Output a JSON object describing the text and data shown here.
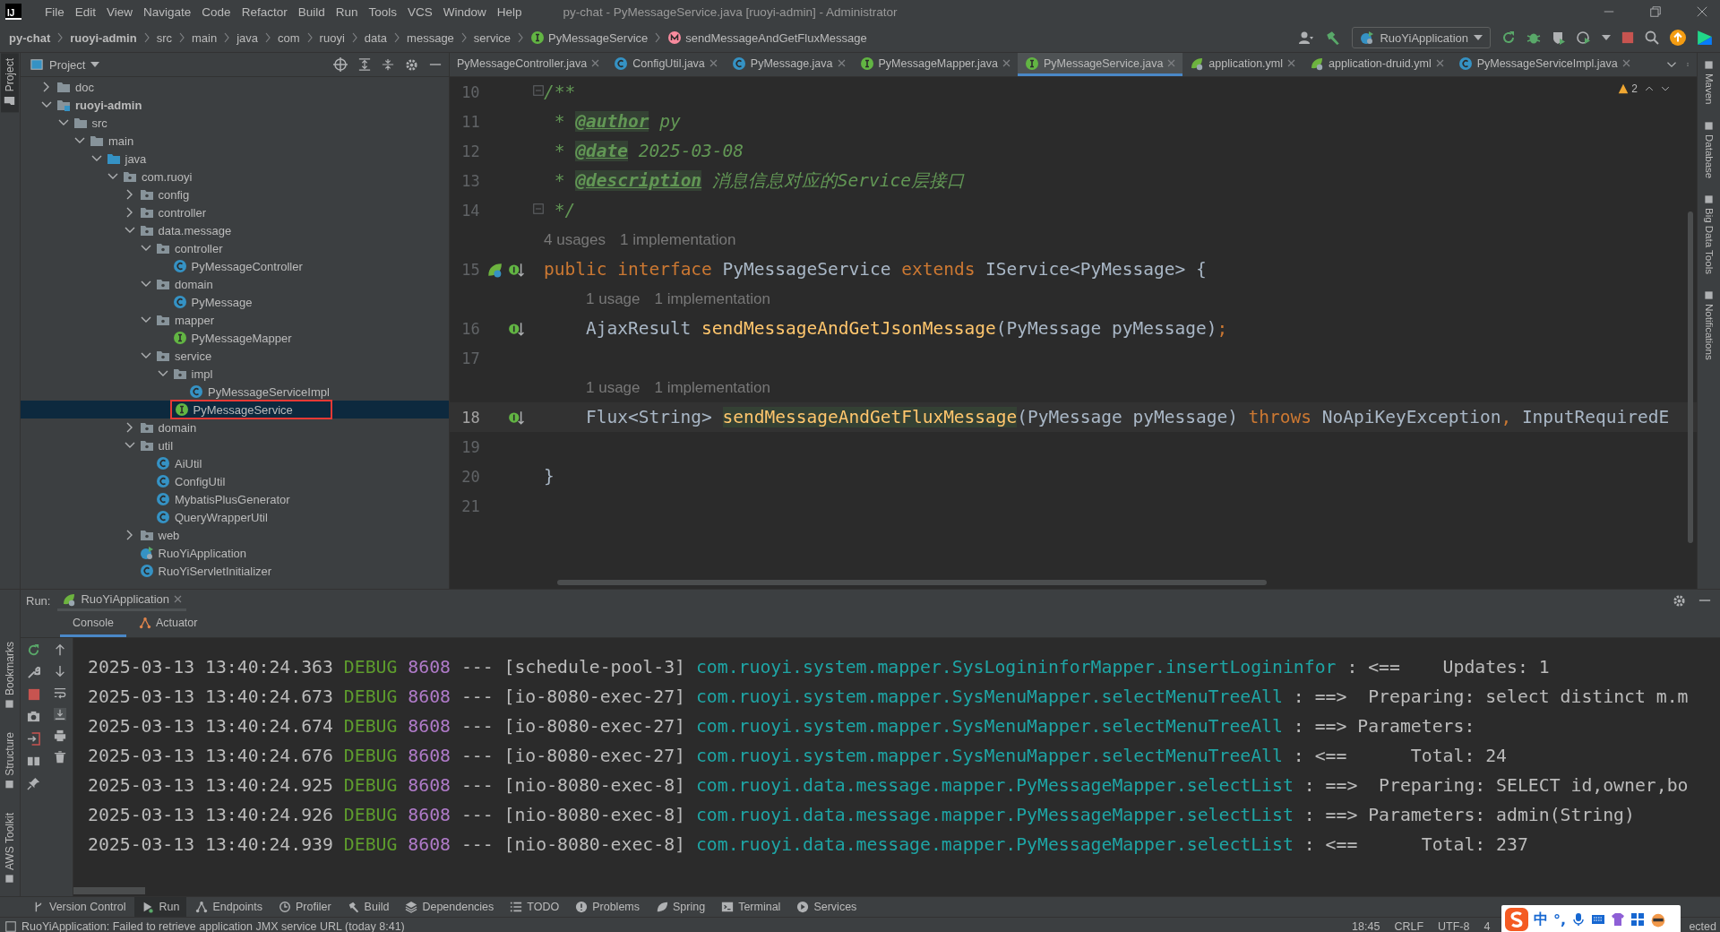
{
  "window": {
    "logo": "IJ",
    "title": "py-chat - PyMessageService.java [ruoyi-admin] - Administrator"
  },
  "menu": [
    "File",
    "Edit",
    "View",
    "Navigate",
    "Code",
    "Refactor",
    "Build",
    "Run",
    "Tools",
    "VCS",
    "Window",
    "Help"
  ],
  "breadcrumbs": [
    {
      "label": "py-chat",
      "kind": "project"
    },
    {
      "label": "ruoyi-admin",
      "kind": "module"
    },
    {
      "label": "src",
      "kind": "folder"
    },
    {
      "label": "main",
      "kind": "folder"
    },
    {
      "label": "java",
      "kind": "folder"
    },
    {
      "label": "com",
      "kind": "folder"
    },
    {
      "label": "ruoyi",
      "kind": "folder"
    },
    {
      "label": "data",
      "kind": "folder"
    },
    {
      "label": "message",
      "kind": "folder"
    },
    {
      "label": "service",
      "kind": "folder"
    },
    {
      "label": "PyMessageService",
      "kind": "interface"
    },
    {
      "label": "sendMessageAndGetFluxMessage",
      "kind": "method"
    }
  ],
  "run_config": "RuoYiApplication",
  "left_stripe_top": [
    {
      "label": "Project",
      "selected": true
    }
  ],
  "left_stripe_bottom": [
    "Bookmarks",
    "Structure",
    "AWS Toolkit"
  ],
  "right_stripe": [
    "Maven",
    "Database",
    "Big Data Tools",
    "Notifications"
  ],
  "project": {
    "title": "Project",
    "tree": [
      {
        "label": "doc",
        "kind": "folder",
        "expanded": false,
        "selected": false,
        "boxed": false
      },
      {
        "label": "ruoyi-admin",
        "kind": "module",
        "expanded": true,
        "selected": false,
        "boxed": false,
        "children": [
          {
            "label": "src",
            "kind": "folder",
            "expanded": true,
            "selected": false,
            "boxed": false,
            "children": [
              {
                "label": "main",
                "kind": "folder",
                "expanded": true,
                "selected": false,
                "boxed": false,
                "children": [
                  {
                    "label": "java",
                    "kind": "source",
                    "expanded": true,
                    "selected": false,
                    "boxed": false,
                    "children": [
                      {
                        "label": "com.ruoyi",
                        "kind": "package",
                        "expanded": true,
                        "selected": false,
                        "boxed": false,
                        "children": [
                          {
                            "label": "config",
                            "kind": "package",
                            "expanded": false,
                            "selected": false,
                            "boxed": false
                          },
                          {
                            "label": "controller",
                            "kind": "package",
                            "expanded": false,
                            "selected": false,
                            "boxed": false
                          },
                          {
                            "label": "data.message",
                            "kind": "package",
                            "expanded": true,
                            "selected": false,
                            "boxed": false,
                            "children": [
                              {
                                "label": "controller",
                                "kind": "package",
                                "expanded": true,
                                "selected": false,
                                "boxed": false,
                                "children": [
                                  {
                                    "label": "PyMessageController",
                                    "kind": "class",
                                    "selected": false,
                                    "boxed": false
                                  }
                                ]
                              },
                              {
                                "label": "domain",
                                "kind": "package",
                                "expanded": true,
                                "selected": false,
                                "boxed": false,
                                "children": [
                                  {
                                    "label": "PyMessage",
                                    "kind": "class",
                                    "selected": false,
                                    "boxed": false
                                  }
                                ]
                              },
                              {
                                "label": "mapper",
                                "kind": "package",
                                "expanded": true,
                                "selected": false,
                                "boxed": false,
                                "children": [
                                  {
                                    "label": "PyMessageMapper",
                                    "kind": "interface",
                                    "selected": false,
                                    "boxed": false
                                  }
                                ]
                              },
                              {
                                "label": "service",
                                "kind": "package",
                                "expanded": true,
                                "selected": false,
                                "boxed": false,
                                "children": [
                                  {
                                    "label": "impl",
                                    "kind": "package",
                                    "expanded": true,
                                    "selected": false,
                                    "boxed": false,
                                    "children": [
                                      {
                                        "label": "PyMessageServiceImpl",
                                        "kind": "class",
                                        "selected": false,
                                        "boxed": false
                                      }
                                    ]
                                  },
                                  {
                                    "label": "PyMessageService",
                                    "kind": "interface",
                                    "selected": true,
                                    "boxed": true
                                  }
                                ]
                              }
                            ]
                          },
                          {
                            "label": "domain",
                            "kind": "package",
                            "expanded": false,
                            "selected": false,
                            "boxed": false
                          },
                          {
                            "label": "util",
                            "kind": "package",
                            "expanded": true,
                            "selected": false,
                            "boxed": false,
                            "children": [
                              {
                                "label": "AiUtil",
                                "kind": "class",
                                "selected": false,
                                "boxed": false
                              },
                              {
                                "label": "ConfigUtil",
                                "kind": "class",
                                "selected": false,
                                "boxed": false
                              },
                              {
                                "label": "MybatisPlusGenerator",
                                "kind": "class",
                                "selected": false,
                                "boxed": false
                              },
                              {
                                "label": "QueryWrapperUtil",
                                "kind": "class",
                                "selected": false,
                                "boxed": false
                              }
                            ]
                          },
                          {
                            "label": "web",
                            "kind": "package",
                            "expanded": false,
                            "selected": false,
                            "boxed": false
                          },
                          {
                            "label": "RuoYiApplication",
                            "kind": "spring",
                            "selected": false,
                            "boxed": false
                          },
                          {
                            "label": "RuoYiServletInitializer",
                            "kind": "class",
                            "selected": false,
                            "boxed": false
                          }
                        ]
                      }
                    ]
                  }
                ]
              }
            ]
          }
        ]
      }
    ]
  },
  "editor_tabs": [
    {
      "label": "PyMessageController.java",
      "kind": "none",
      "selected": false
    },
    {
      "label": "ConfigUtil.java",
      "kind": "class",
      "selected": false
    },
    {
      "label": "PyMessage.java",
      "kind": "class",
      "selected": false
    },
    {
      "label": "PyMessageMapper.java",
      "kind": "interface",
      "selected": false
    },
    {
      "label": "PyMessageService.java",
      "kind": "interface",
      "selected": true
    },
    {
      "label": "application.yml",
      "kind": "yml",
      "selected": false
    },
    {
      "label": "application-druid.yml",
      "kind": "yml",
      "selected": false
    },
    {
      "label": "PyMessageServiceImpl.java",
      "kind": "class",
      "selected": false
    }
  ],
  "editor": {
    "warnings": "2",
    "lines": [
      {
        "kind": "code",
        "number": "10",
        "fold": true,
        "current": false,
        "spring_bean": false,
        "implemented": false,
        "tokens": [
          {
            "text": "/**",
            "kind": "doc"
          }
        ]
      },
      {
        "kind": "code",
        "number": "11",
        "fold": false,
        "current": false,
        "spring_bean": false,
        "implemented": false,
        "tokens": [
          {
            "text": " * ",
            "kind": "doc"
          },
          {
            "text": "@author",
            "kind": "tag"
          },
          {
            "text": " py",
            "kind": "doc"
          }
        ]
      },
      {
        "kind": "code",
        "number": "12",
        "fold": false,
        "current": false,
        "spring_bean": false,
        "implemented": false,
        "tokens": [
          {
            "text": " * ",
            "kind": "doc"
          },
          {
            "text": "@date",
            "kind": "tag"
          },
          {
            "text": " 2025-03-08",
            "kind": "doc"
          }
        ]
      },
      {
        "kind": "code",
        "number": "13",
        "fold": false,
        "current": false,
        "spring_bean": false,
        "implemented": false,
        "tokens": [
          {
            "text": " * ",
            "kind": "doc"
          },
          {
            "text": "@description",
            "kind": "tag"
          },
          {
            "text": " 消息信息对应的Service层接口",
            "kind": "doc"
          }
        ]
      },
      {
        "kind": "code",
        "number": "14",
        "fold": true,
        "current": false,
        "spring_bean": false,
        "implemented": false,
        "tokens": [
          {
            "text": " */",
            "kind": "doc"
          }
        ]
      },
      {
        "kind": "hint",
        "inside": false,
        "items": [
          "4 usages",
          "1 implementation"
        ]
      },
      {
        "kind": "code",
        "number": "15",
        "fold": false,
        "current": false,
        "spring_bean": true,
        "implemented": true,
        "tokens": [
          {
            "text": "public",
            "kind": "keyword"
          },
          {
            "text": " interface",
            "kind": "keyword"
          },
          {
            "text": " PyMessageService ",
            "kind": "plain"
          },
          {
            "text": "extends",
            "kind": "keyword"
          },
          {
            "text": " IService<PyMessage> {",
            "kind": "plain"
          }
        ]
      },
      {
        "kind": "hint",
        "inside": true,
        "items": [
          "1 usage",
          "1 implementation"
        ]
      },
      {
        "kind": "code",
        "number": "16",
        "fold": false,
        "current": false,
        "spring_bean": false,
        "implemented": true,
        "tokens": [
          {
            "text": "    AjaxResult ",
            "kind": "plain"
          },
          {
            "text": "sendMessageAndGetJsonMessage",
            "kind": "method"
          },
          {
            "text": "(PyMessage pyMessage)",
            "kind": "plain"
          },
          {
            "text": ";",
            "kind": "keyword"
          }
        ]
      },
      {
        "kind": "code",
        "number": "17",
        "fold": false,
        "current": false,
        "spring_bean": false,
        "implemented": false
      },
      {
        "kind": "hint",
        "inside": true,
        "items": [
          "1 usage",
          "1 implementation"
        ]
      },
      {
        "kind": "code",
        "number": "18",
        "fold": false,
        "current": true,
        "spring_bean": false,
        "implemented": true,
        "tokens": [
          {
            "text": "    Flux<String> ",
            "kind": "plain"
          },
          {
            "text": "sendMessageAndGetFluxMessage",
            "kind": "method-highlight"
          },
          {
            "text": "(PyMessage pyMessage) ",
            "kind": "plain"
          },
          {
            "text": "throws",
            "kind": "keyword"
          },
          {
            "text": " NoApiKeyException",
            "kind": "plain"
          },
          {
            "text": ",",
            "kind": "keyword"
          },
          {
            "text": " InputRequiredE",
            "kind": "plain"
          }
        ]
      },
      {
        "kind": "code",
        "number": "19",
        "fold": false,
        "current": false,
        "spring_bean": false,
        "implemented": false
      },
      {
        "kind": "code",
        "number": "20",
        "fold": false,
        "current": false,
        "spring_bean": false,
        "implemented": false,
        "tokens": [
          {
            "text": "}",
            "kind": "plain"
          }
        ]
      },
      {
        "kind": "code",
        "number": "21",
        "fold": false,
        "current": false,
        "spring_bean": false,
        "implemented": false
      }
    ]
  },
  "run": {
    "label": "Run:",
    "tabs": [
      {
        "label": "RuoYiApplication",
        "selected": true
      }
    ],
    "subtabs": [
      {
        "label": "Console",
        "kind": "none",
        "selected": true
      },
      {
        "label": "Actuator",
        "kind": "actuator",
        "selected": false
      }
    ],
    "lines": [
      {
        "time": "2025-03-13 13:40:24.363",
        "severity": "DEBUG",
        "pid": "8608",
        "sep": "---",
        "thread": "[schedule-pool-3]",
        "logger": "com.ruoyi.system.mapper.SysLogininforMapper.insertLogininfor",
        "message": " : <==    Updates: 1"
      },
      {
        "time": "2025-03-13 13:40:24.673",
        "severity": "DEBUG",
        "pid": "8608",
        "sep": "---",
        "thread": "[io-8080-exec-27]",
        "logger": "com.ruoyi.system.mapper.SysMenuMapper.selectMenuTreeAll",
        "message": " : ==>  Preparing: select distinct m.m"
      },
      {
        "time": "2025-03-13 13:40:24.674",
        "severity": "DEBUG",
        "pid": "8608",
        "sep": "---",
        "thread": "[io-8080-exec-27]",
        "logger": "com.ruoyi.system.mapper.SysMenuMapper.selectMenuTreeAll",
        "message": " : ==> Parameters:"
      },
      {
        "time": "2025-03-13 13:40:24.676",
        "severity": "DEBUG",
        "pid": "8608",
        "sep": "---",
        "thread": "[io-8080-exec-27]",
        "logger": "com.ruoyi.system.mapper.SysMenuMapper.selectMenuTreeAll",
        "message": " : <==      Total: 24"
      },
      {
        "time": "2025-03-13 13:40:24.925",
        "severity": "DEBUG",
        "pid": "8608",
        "sep": "---",
        "thread": "[nio-8080-exec-8]",
        "logger": "com.ruoyi.data.message.mapper.PyMessageMapper.selectList",
        "message": " : ==>  Preparing: SELECT id,owner,bo"
      },
      {
        "time": "2025-03-13 13:40:24.926",
        "severity": "DEBUG",
        "pid": "8608",
        "sep": "---",
        "thread": "[nio-8080-exec-8]",
        "logger": "com.ruoyi.data.message.mapper.PyMessageMapper.selectList",
        "message": " : ==> Parameters: admin(String)"
      },
      {
        "time": "2025-03-13 13:40:24.939",
        "severity": "DEBUG",
        "pid": "8608",
        "sep": "---",
        "thread": "[nio-8080-exec-8]",
        "logger": "com.ruoyi.data.message.mapper.PyMessageMapper.selectList",
        "message": " : <==      Total: 237"
      }
    ]
  },
  "tool_windows": [
    {
      "label": "Version Control",
      "kind": "vcs",
      "selected": false
    },
    {
      "label": "Run",
      "kind": "run",
      "selected": true
    },
    {
      "label": "Endpoints",
      "kind": "endpoints",
      "selected": false
    },
    {
      "label": "Profiler",
      "kind": "profiler",
      "selected": false
    },
    {
      "label": "Build",
      "kind": "build",
      "selected": false
    },
    {
      "label": "Dependencies",
      "kind": "dependencies",
      "selected": false
    },
    {
      "label": "TODO",
      "kind": "todo",
      "selected": false
    },
    {
      "label": "Problems",
      "kind": "problems",
      "selected": false
    },
    {
      "label": "Spring",
      "kind": "spring",
      "selected": false
    },
    {
      "label": "Terminal",
      "kind": "terminal",
      "selected": false
    },
    {
      "label": "Services",
      "kind": "services",
      "selected": false
    }
  ],
  "status": {
    "message": "RuoYiApplication: Failed to retrieve application JMX service URL (today 8:41)",
    "items": [
      "18:45",
      "CRLF",
      "UTF-8",
      "4"
    ],
    "tail": "ected"
  },
  "ime": {
    "mode": "中",
    "punctuation": "°,"
  }
}
